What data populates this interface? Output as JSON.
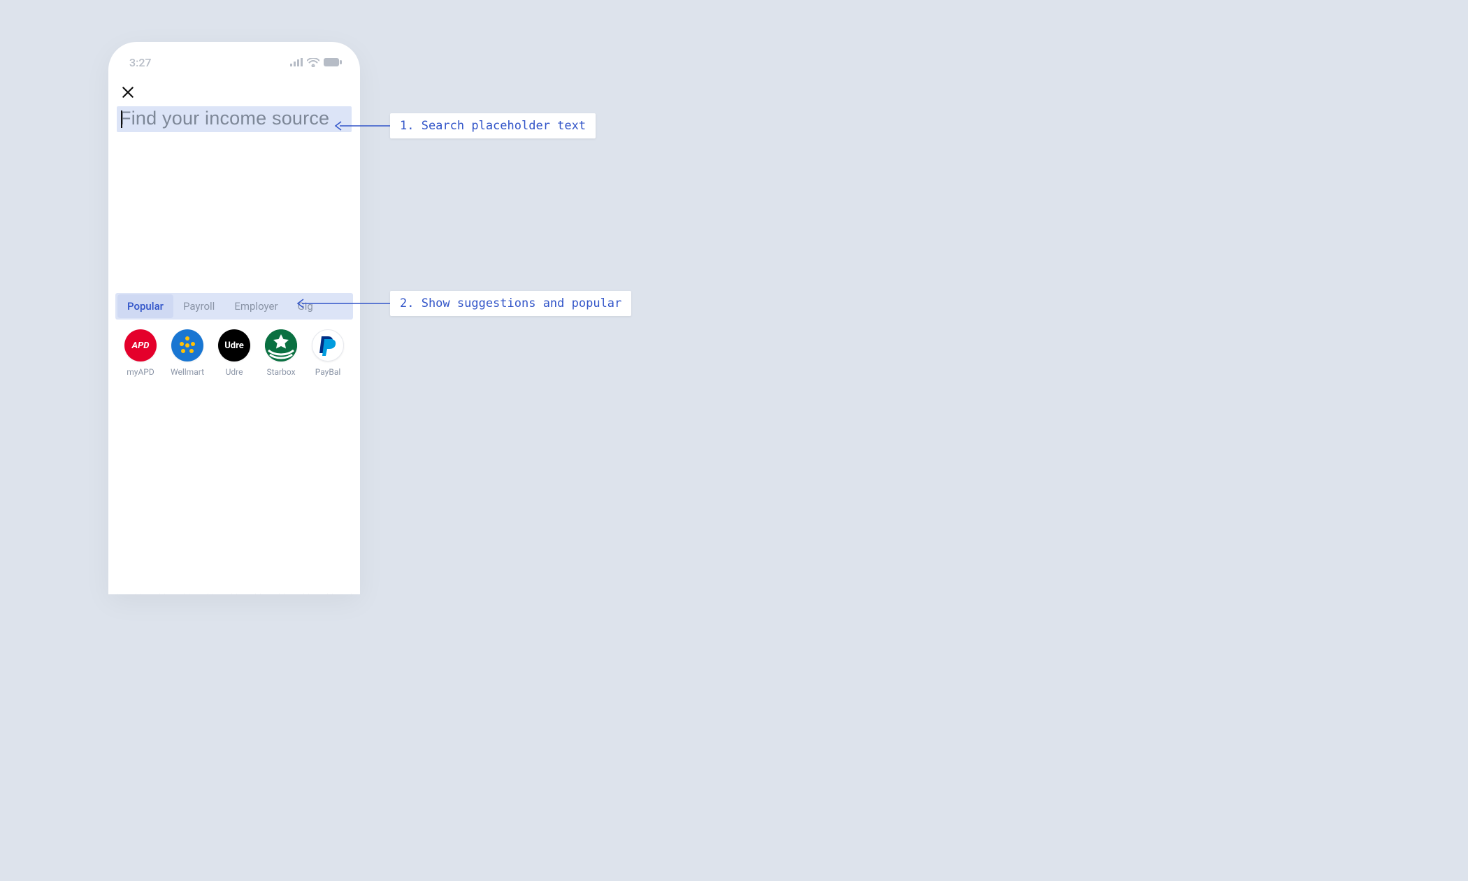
{
  "statusbar": {
    "time": "3:27"
  },
  "search": {
    "placeholder": "Find your income source"
  },
  "tabs": {
    "items": [
      {
        "label": "Popular",
        "active": true
      },
      {
        "label": "Payroll",
        "active": false
      },
      {
        "label": "Employer",
        "active": false
      },
      {
        "label": "Gig",
        "active": false
      }
    ]
  },
  "brands": [
    {
      "label": "myAPD",
      "logo_text": "APD"
    },
    {
      "label": "Wellmart",
      "logo_text": ""
    },
    {
      "label": "Udre",
      "logo_text": "Udre"
    },
    {
      "label": "Starbox",
      "logo_text": ""
    },
    {
      "label": "PayBal",
      "logo_text": ""
    }
  ],
  "annotations": {
    "a1": "1. Search placeholder text",
    "a2": "2. Show suggestions and popular"
  }
}
